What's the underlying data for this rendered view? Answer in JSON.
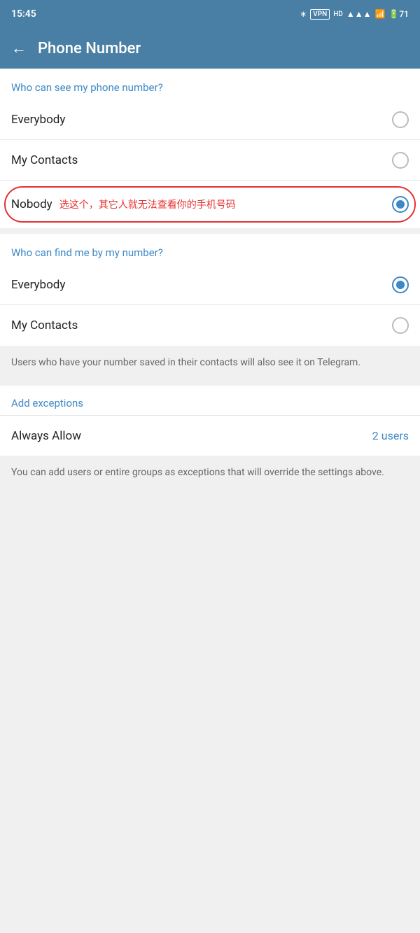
{
  "status_bar": {
    "time": "15:45",
    "icons": "🔵 VPN HD ▲ ▼ 📶 🔋71"
  },
  "toolbar": {
    "back_label": "←",
    "title": "Phone Number"
  },
  "section1": {
    "label": "Who can see my phone number?",
    "options": [
      {
        "id": "everybody1",
        "label": "Everybody",
        "selected": false
      },
      {
        "id": "mycontacts1",
        "label": "My Contacts",
        "selected": false
      },
      {
        "id": "nobody",
        "label": "Nobody",
        "annotation": "选这个，其它人就无法查看你的手机号码",
        "selected": true
      }
    ]
  },
  "section2": {
    "label": "Who can find me by my number?",
    "options": [
      {
        "id": "everybody2",
        "label": "Everybody",
        "selected": true
      },
      {
        "id": "mycontacts2",
        "label": "My Contacts",
        "selected": false
      }
    ],
    "info": "Users who have your number saved in their contacts will also see it on Telegram."
  },
  "exceptions": {
    "label": "Add exceptions",
    "always_allow": {
      "label": "Always Allow",
      "value": "2 users"
    },
    "info": "You can add users or entire groups as exceptions that will override the settings above."
  }
}
